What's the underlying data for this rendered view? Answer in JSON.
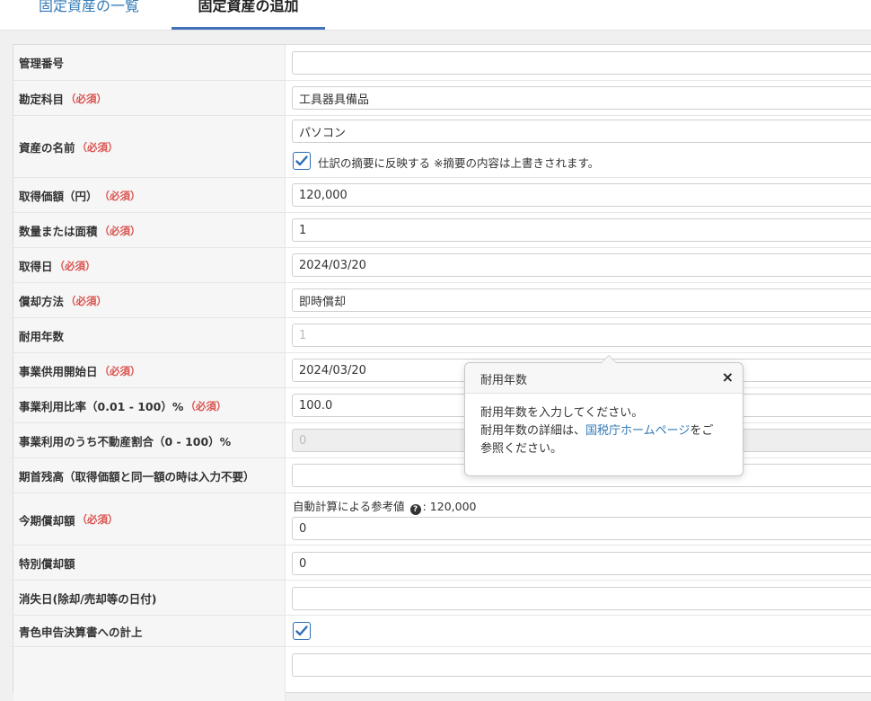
{
  "tabs": {
    "list": "固定資産の一覧",
    "add": "固定資産の追加"
  },
  "required": "（必須）",
  "rows": {
    "mgmt_no": {
      "label": "管理番号",
      "value": ""
    },
    "account": {
      "label": "勘定科目",
      "value": "工具器具備品"
    },
    "asset_name": {
      "label": "資産の名前",
      "value": "パソコン",
      "checkbox_label": "仕訳の摘要に反映する ※摘要の内容は上書きされます。",
      "checked": true
    },
    "acq_price": {
      "label": "取得価額（円）",
      "value": "120,000"
    },
    "quantity": {
      "label": "数量または面積",
      "value": "1"
    },
    "acq_date": {
      "label": "取得日",
      "value": "2024/03/20"
    },
    "depr_method": {
      "label": "償却方法",
      "value": "即時償却"
    },
    "useful_life": {
      "label": "耐用年数",
      "value": "1"
    },
    "start_date": {
      "label": "事業供用開始日",
      "value": "2024/03/20"
    },
    "biz_ratio": {
      "label": "事業利用比率（0.01 - 100）%",
      "value": "100.0"
    },
    "realestate_ratio": {
      "label": "事業利用のうち不動産割合（0 - 100）%",
      "value": "0"
    },
    "opening_balance": {
      "label": "期首残高（取得価額と同一額の時は入力不要）",
      "value": ""
    },
    "current_depr": {
      "label": "今期償却額",
      "hint_prefix": "自動計算による参考値",
      "hint_value": ": 120,000",
      "value": "0"
    },
    "special_depr": {
      "label": "特別償却額",
      "value": "0"
    },
    "disposal_date": {
      "label": "消失日(除却/売却等の日付)",
      "value": ""
    },
    "blue_return": {
      "label": "青色申告決算書への計上",
      "checked": true
    },
    "extra": {
      "label": "",
      "value": ""
    }
  },
  "popover": {
    "title": "耐用年数",
    "close": "×",
    "line1": "耐用年数を入力してください。",
    "line2_pre": "耐用年数の詳細は、",
    "line2_link": "国税庁ホームページ",
    "line2_post": "をご",
    "line3": "参照ください。"
  },
  "colors": {
    "accent": "#4273b8",
    "link": "#337ab7",
    "required": "#d9534f"
  },
  "icons": {
    "check": "checkmark-icon",
    "help": "question-circle-icon",
    "close": "close-icon"
  }
}
